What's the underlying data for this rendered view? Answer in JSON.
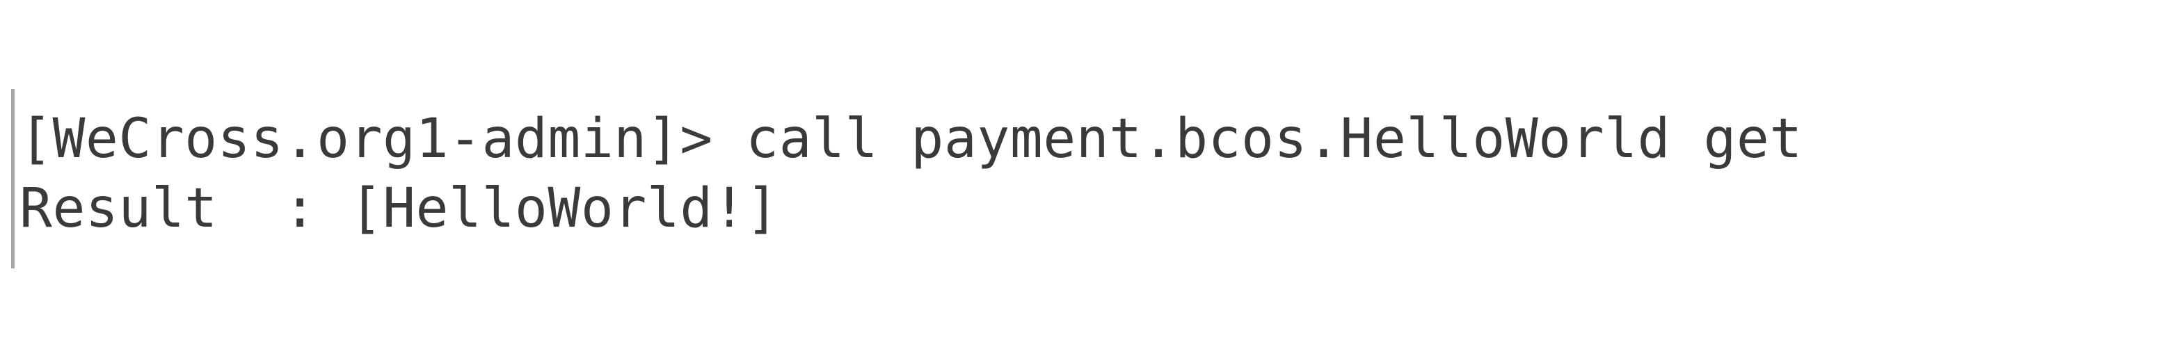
{
  "terminal": {
    "lines": [
      {
        "prompt": "[WeCross.org1-admin]>",
        "command": " call payment.bcos.HelloWorld get"
      },
      {
        "label": "Result  : ",
        "value": "[HelloWorld!]"
      }
    ]
  }
}
